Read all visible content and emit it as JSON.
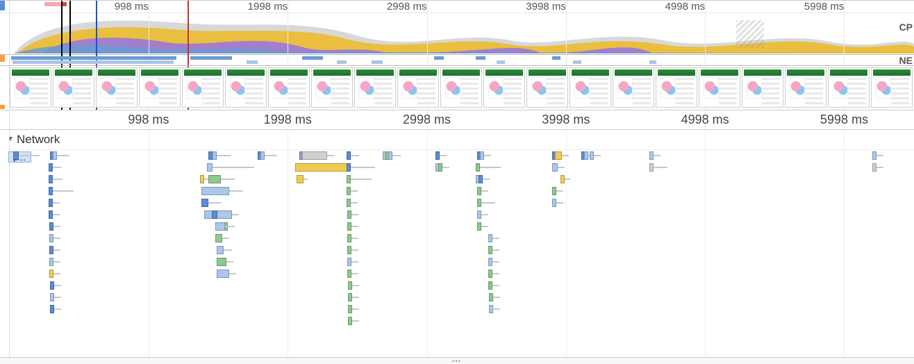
{
  "ruler": {
    "ticks_ms": [
      998,
      1998,
      2998,
      3998,
      4998,
      5998
    ],
    "unit": "ms",
    "total_ms": 6500
  },
  "overview": {
    "cp_label": "CP",
    "ne_label": "NE",
    "markers": {
      "black1_ms": 370,
      "black2_ms": 430,
      "blue_ms": 620,
      "red_ms": 1280
    },
    "pink_region_ms": [
      250,
      370
    ],
    "red_region_ms": [
      370,
      410
    ],
    "net_bars": [
      {
        "start": 10,
        "end": 1200,
        "light": false
      },
      {
        "start": 20,
        "end": 1180,
        "light": true
      },
      {
        "start": 1300,
        "end": 1600,
        "light": false
      },
      {
        "start": 1700,
        "end": 1780,
        "light": true
      },
      {
        "start": 2100,
        "end": 2250,
        "light": false
      },
      {
        "start": 2350,
        "end": 2420,
        "light": true
      },
      {
        "start": 2600,
        "end": 2680,
        "light": true
      },
      {
        "start": 3050,
        "end": 3120,
        "light": false
      },
      {
        "start": 3350,
        "end": 3420,
        "light": false
      },
      {
        "start": 3500,
        "end": 3560,
        "light": true
      },
      {
        "start": 3900,
        "end": 3960,
        "light": false
      },
      {
        "start": 4050,
        "end": 4110,
        "light": true
      },
      {
        "start": 4600,
        "end": 4650,
        "light": true
      }
    ]
  },
  "filmstrip": {
    "count": 21
  },
  "network_section": {
    "title": "Network",
    "first_request_label": "p…"
  },
  "waterfall_rows": [
    {
      "y": 0,
      "name": true,
      "items": [
        {
          "t": 25,
          "w": 8,
          "wait": 30,
          "c": "blue"
        }
      ]
    },
    {
      "y": 0,
      "items": [
        {
          "t": 290,
          "w": 8,
          "wait": 20,
          "c": "blue"
        },
        {
          "t": 310,
          "w": 6,
          "wait": 18,
          "c": "lblue"
        }
      ]
    },
    {
      "y": 1,
      "items": [
        {
          "t": 280,
          "w": 6,
          "wait": 12,
          "c": "blue"
        }
      ]
    },
    {
      "y": 2,
      "items": [
        {
          "t": 280,
          "w": 6,
          "wait": 14,
          "c": "blue"
        }
      ]
    },
    {
      "y": 3,
      "items": [
        {
          "t": 280,
          "w": 6,
          "wait": 30,
          "c": "blue"
        }
      ]
    },
    {
      "y": 4,
      "items": [
        {
          "t": 282,
          "w": 6,
          "wait": 10,
          "c": "blue"
        }
      ]
    },
    {
      "y": 5,
      "items": [
        {
          "t": 282,
          "w": 6,
          "wait": 10,
          "c": "blue"
        }
      ]
    },
    {
      "y": 6,
      "items": [
        {
          "t": 284,
          "w": 6,
          "wait": 10,
          "c": "blue"
        }
      ]
    },
    {
      "y": 7,
      "items": [
        {
          "t": 284,
          "w": 6,
          "wait": 10,
          "c": "lblue"
        }
      ]
    },
    {
      "y": 8,
      "items": [
        {
          "t": 286,
          "w": 6,
          "wait": 10,
          "c": "blue"
        }
      ]
    },
    {
      "y": 9,
      "items": [
        {
          "t": 286,
          "w": 6,
          "wait": 10,
          "c": "lblue"
        }
      ]
    },
    {
      "y": 10,
      "items": [
        {
          "t": 286,
          "w": 6,
          "wait": 10,
          "c": "yellow"
        }
      ]
    },
    {
      "y": 11,
      "items": [
        {
          "t": 288,
          "w": 6,
          "wait": 10,
          "c": "blue"
        }
      ]
    },
    {
      "y": 12,
      "items": [
        {
          "t": 290,
          "w": 6,
          "wait": 10,
          "c": "lblue"
        }
      ]
    },
    {
      "y": 13,
      "items": [
        {
          "t": 290,
          "w": 6,
          "wait": 10,
          "c": "blue"
        }
      ]
    },
    {
      "y": 0,
      "items": [
        {
          "t": 1430,
          "w": 7,
          "wait": 25,
          "c": "blue"
        },
        {
          "t": 1460,
          "w": 6,
          "wait": 20,
          "c": "lblue"
        }
      ]
    },
    {
      "y": 1,
      "items": [
        {
          "t": 1420,
          "w": 8,
          "wait": 60,
          "c": "lblue"
        }
      ]
    },
    {
      "y": 2,
      "items": [
        {
          "t": 1370,
          "w": 6,
          "wait": 15,
          "c": "yellow"
        },
        {
          "t": 1430,
          "w": 18,
          "wait": 20,
          "c": "green"
        }
      ]
    },
    {
      "y": 3,
      "items": [
        {
          "t": 1380,
          "w": 40,
          "wait": 20,
          "c": "lblue"
        }
      ]
    },
    {
      "y": 4,
      "items": [
        {
          "t": 1380,
          "w": 10,
          "wait": 18,
          "c": "blue"
        }
      ]
    },
    {
      "y": 5,
      "items": [
        {
          "t": 1400,
          "w": 40,
          "wait": 10,
          "c": "lblue"
        },
        {
          "t": 1455,
          "w": 8,
          "wait": 14,
          "c": "blue"
        }
      ]
    },
    {
      "y": 6,
      "items": [
        {
          "t": 1500,
          "w": 14,
          "wait": 10,
          "c": "green"
        }
      ]
    },
    {
      "y": 6,
      "items": [
        {
          "t": 1480,
          "w": 14,
          "wait": 10,
          "c": "lblue"
        }
      ]
    },
    {
      "y": 7,
      "items": [
        {
          "t": 1480,
          "w": 10,
          "wait": 10,
          "c": "green"
        }
      ]
    },
    {
      "y": 8,
      "items": [
        {
          "t": 1490,
          "w": 10,
          "wait": 12,
          "c": "lblue"
        }
      ]
    },
    {
      "y": 9,
      "items": [
        {
          "t": 1490,
          "w": 14,
          "wait": 10,
          "c": "green"
        }
      ]
    },
    {
      "y": 10,
      "items": [
        {
          "t": 1490,
          "w": 18,
          "wait": 10,
          "c": "lblue"
        }
      ]
    },
    {
      "y": 0,
      "items": [
        {
          "t": 1780,
          "w": 6,
          "wait": 15,
          "c": "blue"
        },
        {
          "t": 1800,
          "w": 6,
          "wait": 18,
          "c": "lblue"
        }
      ]
    },
    {
      "y": 0,
      "items": [
        {
          "t": 2080,
          "w": 8,
          "wait": 12,
          "c": "purple"
        },
        {
          "t": 2100,
          "w": 36,
          "wait": 10,
          "c": "grey"
        }
      ]
    },
    {
      "y": 1,
      "items": [
        {
          "t": 2050,
          "w": 80,
          "wait": 10,
          "c": "yellow"
        }
      ]
    },
    {
      "y": 2,
      "items": [
        {
          "t": 2060,
          "w": 10,
          "wait": 6,
          "c": "yellow"
        }
      ]
    },
    {
      "y": 0,
      "items": [
        {
          "t": 2420,
          "w": 6,
          "wait": 12,
          "c": "blue"
        }
      ]
    },
    {
      "y": 1,
      "items": [
        {
          "t": 2420,
          "w": 6,
          "wait": 35,
          "c": "blue"
        }
      ]
    },
    {
      "y": 2,
      "items": [
        {
          "t": 2420,
          "w": 6,
          "wait": 30,
          "c": "green"
        }
      ]
    },
    {
      "y": 3,
      "items": [
        {
          "t": 2422,
          "w": 6,
          "wait": 10,
          "c": "green"
        }
      ]
    },
    {
      "y": 4,
      "items": [
        {
          "t": 2422,
          "w": 6,
          "wait": 10,
          "c": "green"
        }
      ]
    },
    {
      "y": 5,
      "items": [
        {
          "t": 2424,
          "w": 6,
          "wait": 10,
          "c": "green"
        }
      ]
    },
    {
      "y": 6,
      "items": [
        {
          "t": 2424,
          "w": 6,
          "wait": 10,
          "c": "green"
        }
      ]
    },
    {
      "y": 7,
      "items": [
        {
          "t": 2426,
          "w": 6,
          "wait": 10,
          "c": "green"
        }
      ]
    },
    {
      "y": 8,
      "items": [
        {
          "t": 2426,
          "w": 6,
          "wait": 10,
          "c": "green"
        }
      ]
    },
    {
      "y": 9,
      "items": [
        {
          "t": 2428,
          "w": 6,
          "wait": 10,
          "c": "lblue"
        }
      ]
    },
    {
      "y": 10,
      "items": [
        {
          "t": 2428,
          "w": 6,
          "wait": 10,
          "c": "green"
        }
      ]
    },
    {
      "y": 11,
      "items": [
        {
          "t": 2430,
          "w": 6,
          "wait": 10,
          "c": "green"
        }
      ]
    },
    {
      "y": 12,
      "items": [
        {
          "t": 2430,
          "w": 6,
          "wait": 10,
          "c": "green"
        }
      ]
    },
    {
      "y": 13,
      "items": [
        {
          "t": 2432,
          "w": 6,
          "wait": 10,
          "c": "green"
        }
      ]
    },
    {
      "y": 14,
      "items": [
        {
          "t": 2432,
          "w": 6,
          "wait": 10,
          "c": "green"
        }
      ]
    },
    {
      "y": 0,
      "items": [
        {
          "t": 2680,
          "w": 6,
          "wait": 12,
          "c": "lblue"
        },
        {
          "t": 2700,
          "w": 6,
          "wait": 12,
          "c": "green"
        },
        {
          "t": 2720,
          "w": 6,
          "wait": 12,
          "c": "lblue"
        }
      ]
    },
    {
      "y": 0,
      "items": [
        {
          "t": 3060,
          "w": 6,
          "wait": 10,
          "c": "blue"
        }
      ]
    },
    {
      "y": 1,
      "items": [
        {
          "t": 3060,
          "w": 6,
          "wait": 10,
          "c": "lblue"
        }
      ]
    },
    {
      "y": 1,
      "items": [
        {
          "t": 3080,
          "w": 6,
          "wait": 10,
          "c": "green"
        }
      ]
    },
    {
      "y": 0,
      "items": [
        {
          "t": 3360,
          "w": 6,
          "wait": 10,
          "c": "blue"
        },
        {
          "t": 3380,
          "w": 6,
          "wait": 10,
          "c": "lblue"
        }
      ]
    },
    {
      "y": 1,
      "items": [
        {
          "t": 3350,
          "w": 6,
          "wait": 30,
          "c": "green"
        }
      ]
    },
    {
      "y": 2,
      "items": [
        {
          "t": 3350,
          "w": 6,
          "wait": 10,
          "c": "lblue"
        }
      ]
    },
    {
      "y": 2,
      "items": [
        {
          "t": 3370,
          "w": 6,
          "wait": 10,
          "c": "blue"
        }
      ]
    },
    {
      "y": 3,
      "items": [
        {
          "t": 3360,
          "w": 6,
          "wait": 10,
          "c": "green"
        }
      ]
    },
    {
      "y": 4,
      "items": [
        {
          "t": 3360,
          "w": 6,
          "wait": 20,
          "c": "green"
        }
      ]
    },
    {
      "y": 5,
      "items": [
        {
          "t": 3362,
          "w": 6,
          "wait": 10,
          "c": "lblue"
        }
      ]
    },
    {
      "y": 6,
      "items": [
        {
          "t": 3362,
          "w": 6,
          "wait": 10,
          "c": "green"
        }
      ]
    },
    {
      "y": 7,
      "items": [
        {
          "t": 3440,
          "w": 6,
          "wait": 10,
          "c": "lblue"
        }
      ]
    },
    {
      "y": 8,
      "items": [
        {
          "t": 3440,
          "w": 6,
          "wait": 10,
          "c": "green"
        }
      ]
    },
    {
      "y": 9,
      "items": [
        {
          "t": 3440,
          "w": 6,
          "wait": 10,
          "c": "lblue"
        }
      ]
    },
    {
      "y": 10,
      "items": [
        {
          "t": 3442,
          "w": 6,
          "wait": 10,
          "c": "green"
        }
      ]
    },
    {
      "y": 11,
      "items": [
        {
          "t": 3442,
          "w": 6,
          "wait": 10,
          "c": "green"
        }
      ]
    },
    {
      "y": 12,
      "items": [
        {
          "t": 3444,
          "w": 6,
          "wait": 10,
          "c": "green"
        }
      ]
    },
    {
      "y": 13,
      "items": [
        {
          "t": 3444,
          "w": 6,
          "wait": 10,
          "c": "lblue"
        }
      ]
    },
    {
      "y": 0,
      "items": [
        {
          "t": 3900,
          "w": 6,
          "wait": 10,
          "c": "blue"
        },
        {
          "t": 3920,
          "w": 10,
          "wait": 10,
          "c": "yellow"
        }
      ]
    },
    {
      "y": 1,
      "items": [
        {
          "t": 3900,
          "w": 8,
          "wait": 10,
          "c": "lblue"
        }
      ]
    },
    {
      "y": 2,
      "items": [
        {
          "t": 3960,
          "w": 6,
          "wait": 8,
          "c": "yellow"
        }
      ]
    },
    {
      "y": 3,
      "items": [
        {
          "t": 3900,
          "w": 6,
          "wait": 10,
          "c": "green"
        }
      ]
    },
    {
      "y": 4,
      "items": [
        {
          "t": 3900,
          "w": 6,
          "wait": 10,
          "c": "lblue"
        }
      ]
    },
    {
      "y": 0,
      "items": [
        {
          "t": 4110,
          "w": 6,
          "wait": 10,
          "c": "blue"
        },
        {
          "t": 4130,
          "w": 6,
          "wait": 14,
          "c": "lblue"
        }
      ]
    },
    {
      "y": 0,
      "items": [
        {
          "t": 4170,
          "w": 6,
          "wait": 10,
          "c": "lblue"
        }
      ]
    },
    {
      "y": 0,
      "items": [
        {
          "t": 4600,
          "w": 6,
          "wait": 10,
          "c": "lblue"
        }
      ]
    },
    {
      "y": 1,
      "items": [
        {
          "t": 4600,
          "w": 6,
          "wait": 20,
          "c": "grey"
        }
      ]
    },
    {
      "y": 0,
      "items": [
        {
          "t": 6200,
          "w": 6,
          "wait": 10,
          "c": "lblue"
        }
      ]
    },
    {
      "y": 1,
      "items": [
        {
          "t": 6200,
          "w": 6,
          "wait": 10,
          "c": "grey"
        }
      ]
    }
  ],
  "splitter_glyph": "⋯"
}
